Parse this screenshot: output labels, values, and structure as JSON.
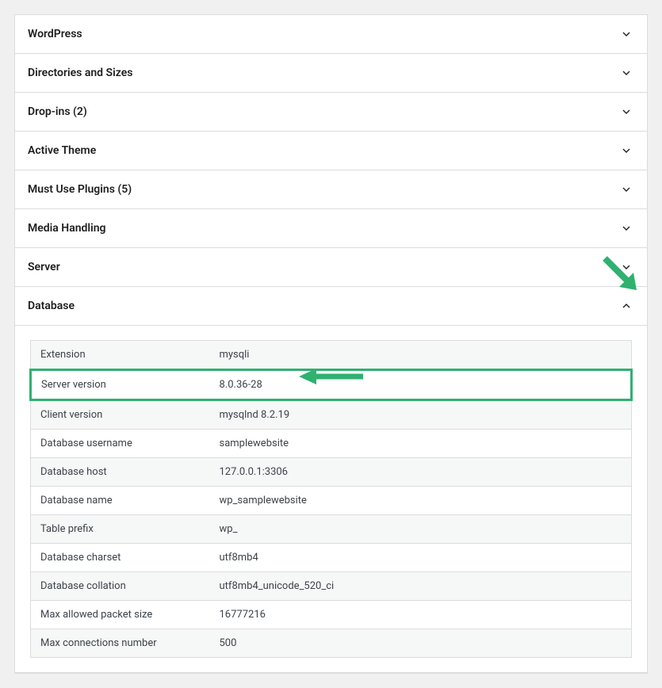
{
  "panels": {
    "wordpress": {
      "title": "WordPress"
    },
    "directories": {
      "title": "Directories and Sizes"
    },
    "dropins": {
      "title": "Drop-ins (2)"
    },
    "activeTheme": {
      "title": "Active Theme"
    },
    "mustUsePlugins": {
      "title": "Must Use Plugins (5)"
    },
    "mediaHandling": {
      "title": "Media Handling"
    },
    "server": {
      "title": "Server"
    },
    "database": {
      "title": "Database"
    }
  },
  "databaseRows": {
    "extension": {
      "label": "Extension",
      "value": "mysqli"
    },
    "serverVersion": {
      "label": "Server version",
      "value": "8.0.36-28"
    },
    "clientVersion": {
      "label": "Client version",
      "value": "mysqlnd 8.2.19"
    },
    "dbUsername": {
      "label": "Database username",
      "value": "samplewebsite"
    },
    "dbHost": {
      "label": "Database host",
      "value": "127.0.0.1:3306"
    },
    "dbName": {
      "label": "Database name",
      "value": "wp_samplewebsite"
    },
    "tablePrefix": {
      "label": "Table prefix",
      "value": "wp_"
    },
    "dbCharset": {
      "label": "Database charset",
      "value": "utf8mb4"
    },
    "dbCollation": {
      "label": "Database collation",
      "value": "utf8mb4_unicode_520_ci"
    },
    "maxPacket": {
      "label": "Max allowed packet size",
      "value": "16777216"
    },
    "maxConnections": {
      "label": "Max connections number",
      "value": "500"
    }
  }
}
